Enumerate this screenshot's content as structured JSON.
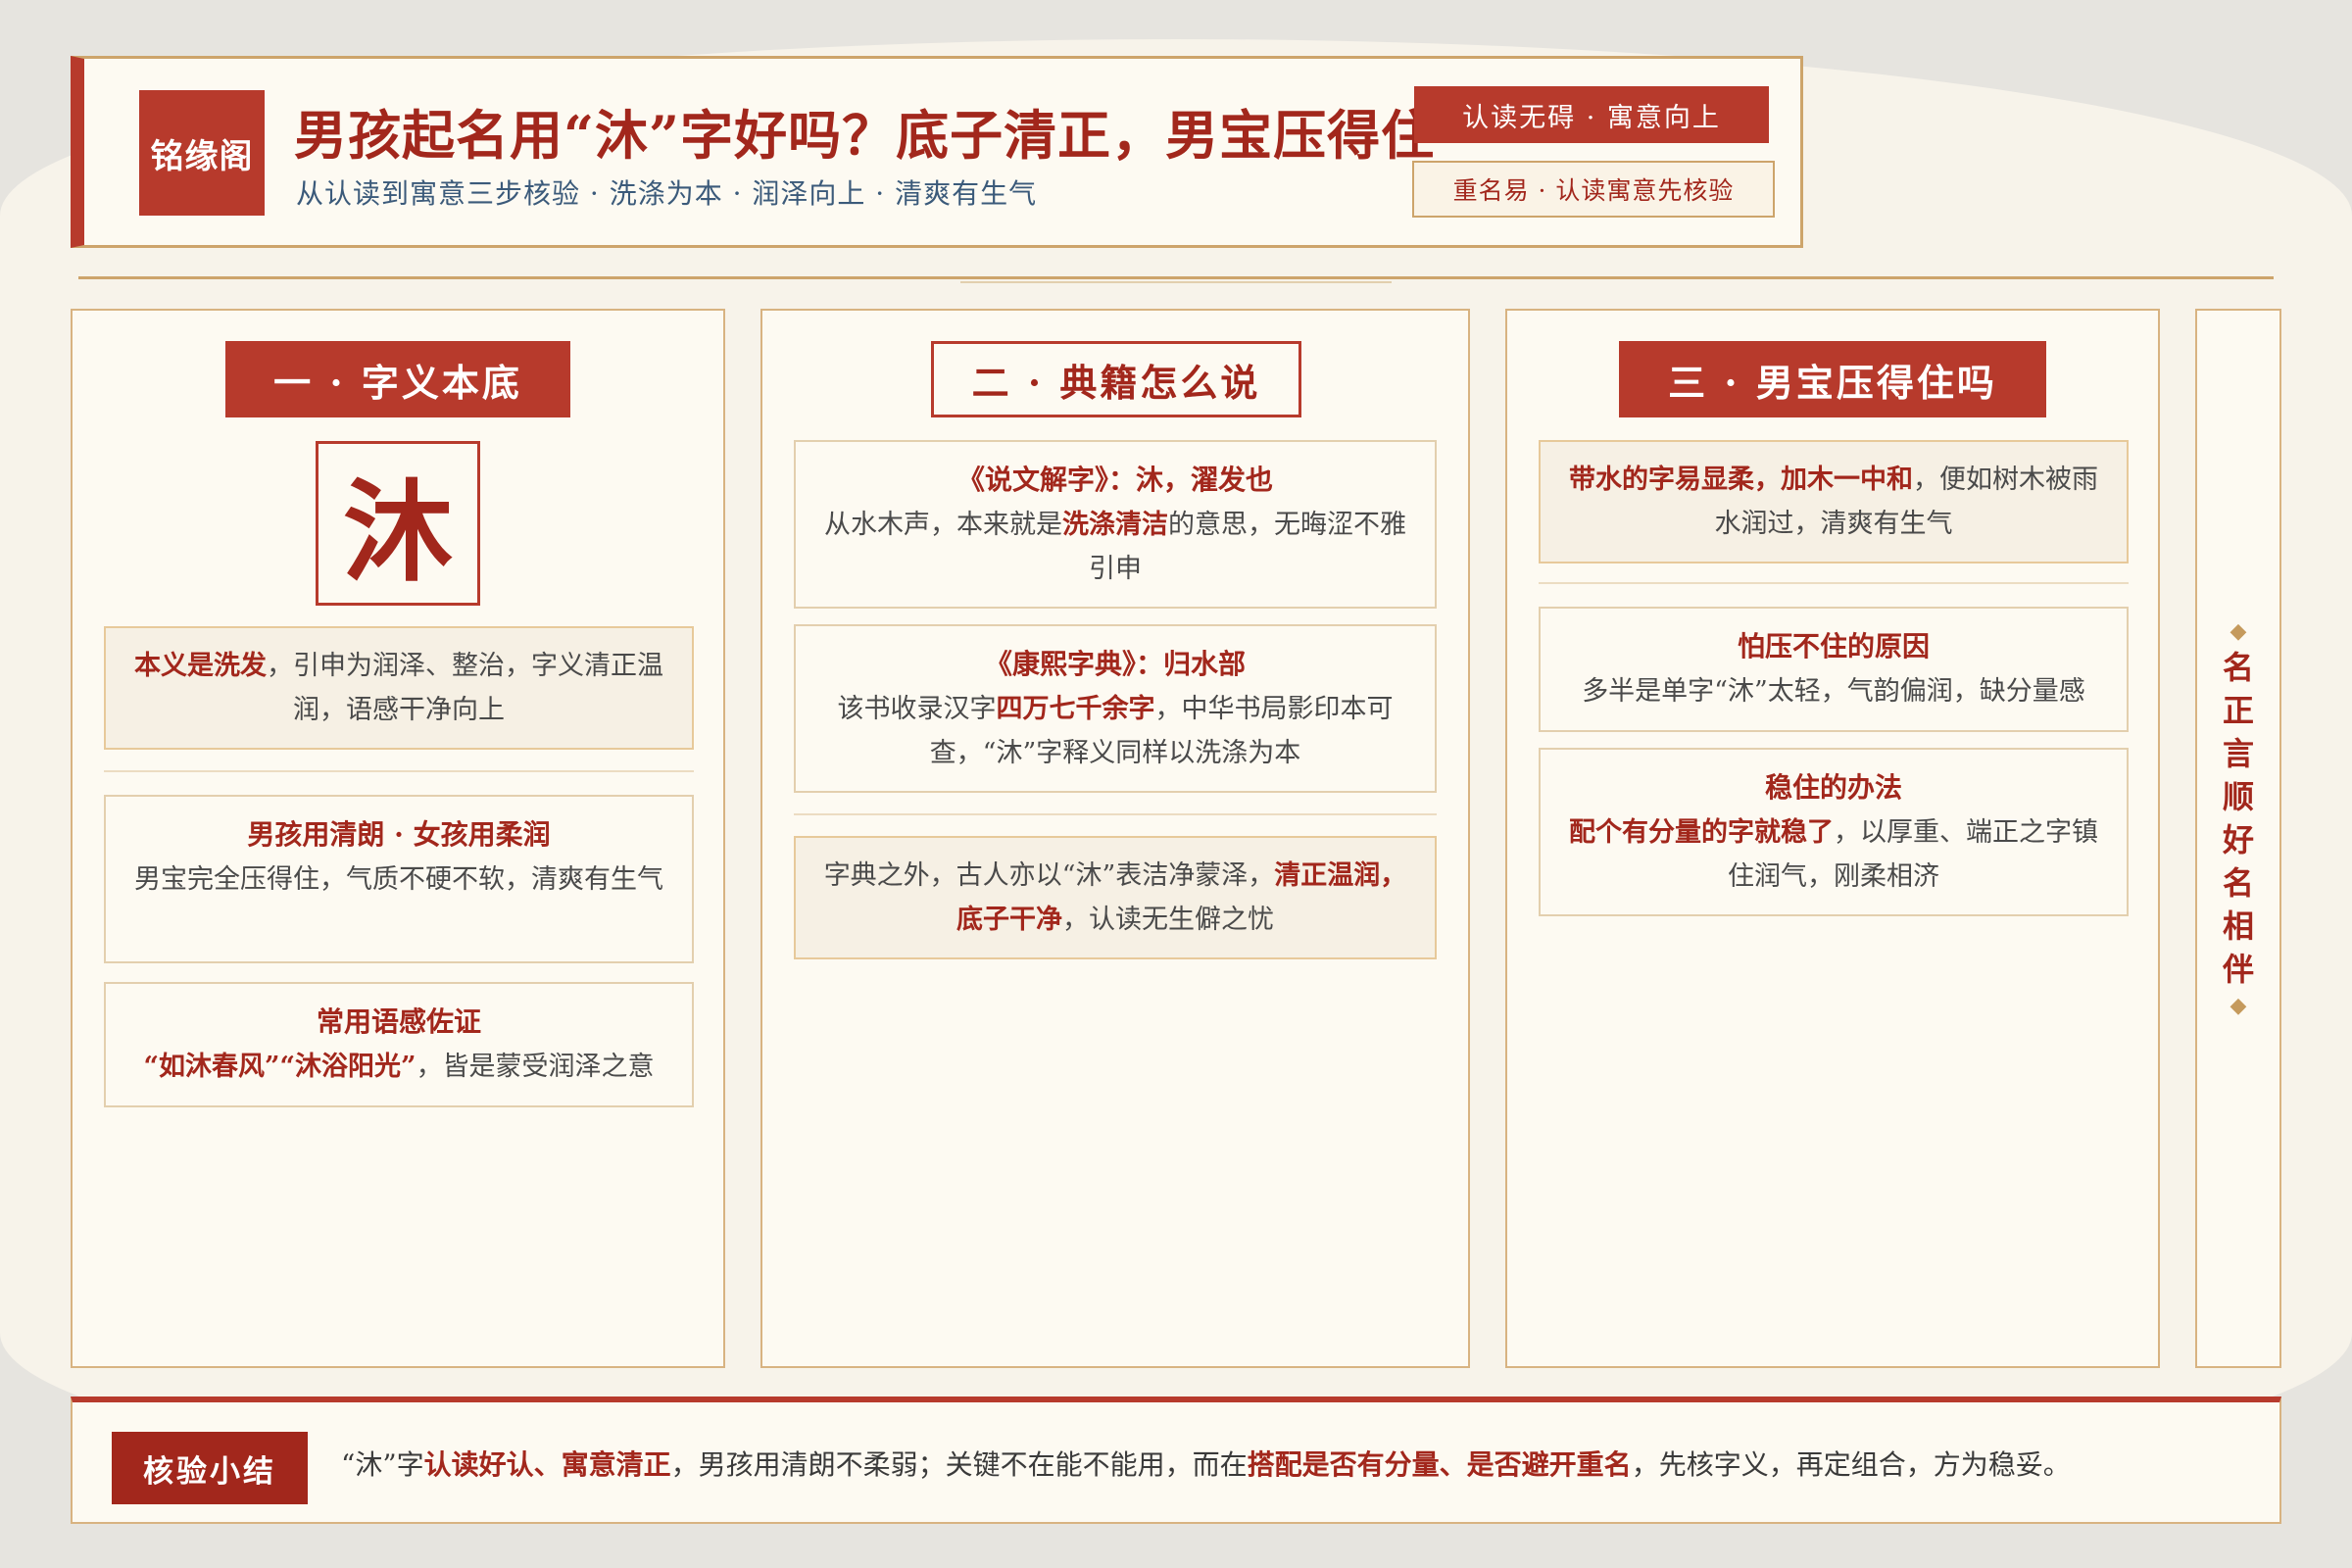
{
  "header": {
    "logo": "铭缘阁",
    "title": "男孩起名用“沐”字好吗？底子清正，男宝压得住",
    "subtitle": "从认读到寓意三步核验 · 洗涤为本 · 润泽向上 · 清爽有生气",
    "badge_primary": "认读无碍 · 寓意向上",
    "badge_secondary": "重名易 · 认读寓意先核验"
  },
  "section1": {
    "heading": "一 · 字义本底",
    "character": "沐",
    "card1": {
      "hl": "本义是洗发",
      "text": "，引申为润泽、整治，字义清正温润，语感干净向上"
    },
    "card2": {
      "title": "男孩用清朗 · 女孩用柔润",
      "text": "男宝完全压得住，气质不硬不软，清爽有生气"
    },
    "card3": {
      "title": "常用语感佐证",
      "hl": "“如沐春风”“沐浴阳光”",
      "text": "，皆是蒙受润泽之意"
    }
  },
  "section2": {
    "heading": "二 · 典籍怎么说",
    "card1": {
      "title": "《说文解字》：沐，濯发也",
      "text_a": "从水木声，本来就是",
      "hl": "洗涤清洁",
      "text_b": "的意思，无晦涩不雅引申"
    },
    "card2": {
      "title": "《康熙字典》：归水部",
      "text_a": "该书收录汉字",
      "hl": "四万七千余字",
      "text_b": "，中华书局影印本可查，“沐”字释义同样以洗涤为本"
    },
    "card3": {
      "text_a": "字典之外，古人亦以“沐”表洁净蒙泽，",
      "hl": "清正温润，底子干净",
      "text_b": "，认读无生僻之忧"
    }
  },
  "section3": {
    "heading": "三 · 男宝压得住吗",
    "card1": {
      "hl": "带水的字易显柔，加木一中和",
      "text": "，便如树木被雨水润过，清爽有生气"
    },
    "card2": {
      "title": "怕压不住的原因",
      "text": "多半是单字“沐”太轻，气韵偏润，缺分量感"
    },
    "card3": {
      "title": "稳住的办法",
      "hl": "配个有分量的字就稳了",
      "text": "，以厚重、端正之字镇住润气，刚柔相济"
    }
  },
  "side": {
    "chars": [
      "名",
      "正",
      "言",
      "顺",
      "好",
      "名",
      "相",
      "伴"
    ],
    "diamond": "◆"
  },
  "summary": {
    "label": "核验小结",
    "t1": "“沐”字",
    "h1": "认读好认、寓意清正",
    "t2": "，男孩用清朗不柔弱；关键不在能不能用，而在",
    "h2": "搭配是否有分量、是否避开重名",
    "t3": "，先核字义，再定组合，方为稳妥。"
  },
  "colors": {
    "accent": "#b73a2c",
    "accent_dark": "#a2271c",
    "gold": "#cda46b",
    "paper": "#fdfaf2",
    "subtitle_blue": "#3b5a7a"
  }
}
